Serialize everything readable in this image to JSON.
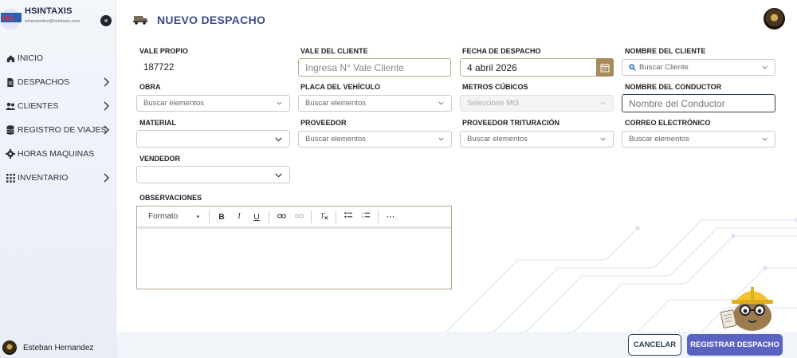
{
  "brand": {
    "name": "HSINTAXIS",
    "email": "tchernandez@hsintaxis.com"
  },
  "sidebar": {
    "items": [
      {
        "label": "INICIO",
        "icon": "home-icon",
        "has_children": false
      },
      {
        "label": "DESPACHOS",
        "icon": "document-icon",
        "has_children": true
      },
      {
        "label": "CLIENTES",
        "icon": "users-icon",
        "has_children": true
      },
      {
        "label": "REGISTRO DE VIAJES",
        "icon": "database-icon",
        "has_children": true
      },
      {
        "label": "HORAS MAQUINAS",
        "icon": "gear-icon",
        "has_children": false
      },
      {
        "label": "INVENTARIO",
        "icon": "grid-icon",
        "has_children": true
      }
    ],
    "user_name": "Esteban Hernandez"
  },
  "header": {
    "title": "NUEVO DESPACHO"
  },
  "form": {
    "vale_propio": {
      "label": "VALE PROPIO",
      "value": "187722"
    },
    "vale_cliente": {
      "label": "VALE DEL CLIENTE",
      "placeholder": "Ingresa N° Vale Cliente"
    },
    "fecha": {
      "label": "FECHA DE DESPACHO",
      "value": "4 abril 2026"
    },
    "nombre_cliente": {
      "label": "NOMBRE DEL CLIENTE",
      "placeholder": "Buscar Cliente"
    },
    "obra": {
      "label": "OBRA",
      "placeholder": "Buscar elementos"
    },
    "placa": {
      "label": "PLACA DEL VEHÍCULO",
      "placeholder": "Buscar elementos"
    },
    "metros": {
      "label": "METROS CÚBICOS",
      "placeholder": "Seleccione Mt3"
    },
    "conductor": {
      "label": "NOMBRE DEL CONDUCTOR",
      "placeholder": "Nombre del Conductor"
    },
    "material": {
      "label": "MATERIAL",
      "placeholder": ""
    },
    "proveedor": {
      "label": "PROVEEDOR",
      "placeholder": "Buscar elementos"
    },
    "proveedor_trit": {
      "label": "PROVEEDOR TRITURACIÓN",
      "placeholder": "Buscar elementos"
    },
    "correo": {
      "label": "CORREO ELECTRÓNICO",
      "placeholder": "Buscar elementos"
    },
    "vendedor": {
      "label": "VENDEDOR",
      "placeholder": ""
    },
    "observaciones": {
      "label": "OBSERVACIONES",
      "format_label": "Formato",
      "more": "⋯"
    }
  },
  "actions": {
    "cancel": "CANCELAR",
    "submit": "REGISTRAR DESPACHO"
  },
  "colors": {
    "accent": "#5b63c2",
    "title": "#3c4a8a",
    "input_border": "#b9a98a",
    "calendar": "#a78a5b"
  }
}
